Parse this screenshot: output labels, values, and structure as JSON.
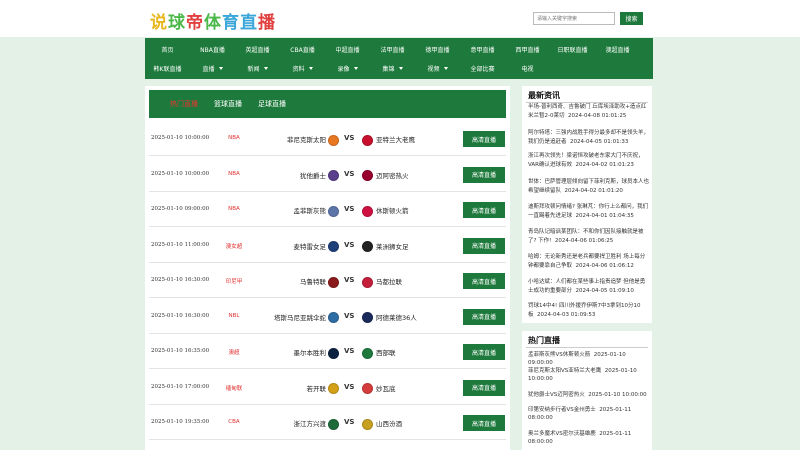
{
  "brand": {
    "chars": [
      "说",
      "球",
      "帝",
      "体",
      "育",
      "直",
      "播"
    ],
    "colors": [
      "#e8b820",
      "#4cb84a",
      "#e04040",
      "#4cb84a",
      "#3aa5d8",
      "#3aa5d8",
      "#e04040"
    ]
  },
  "search": {
    "placeholder": "请输入关键字搜索",
    "button": "搜索"
  },
  "nav": {
    "row1": [
      {
        "label": "首页"
      },
      {
        "label": "NBA直播"
      },
      {
        "label": "英超直播"
      },
      {
        "label": "CBA直播"
      },
      {
        "label": "中超直播"
      },
      {
        "label": "法甲直播"
      },
      {
        "label": "德甲直播"
      },
      {
        "label": "意甲直播"
      },
      {
        "label": "西甲直播"
      },
      {
        "label": "日职联直播"
      },
      {
        "label": "澳超直播"
      }
    ],
    "row2": [
      {
        "label": "韩K联直播",
        "dropdown": false
      },
      {
        "label": "直播",
        "dropdown": true
      },
      {
        "label": "新闻",
        "dropdown": true
      },
      {
        "label": "资料",
        "dropdown": true
      },
      {
        "label": "录像",
        "dropdown": true
      },
      {
        "label": "集锦",
        "dropdown": true
      },
      {
        "label": "视频",
        "dropdown": true
      },
      {
        "label": "全部比赛",
        "dropdown": false
      },
      {
        "label": "电视",
        "dropdown": false
      }
    ]
  },
  "tabs": [
    "热门直播",
    "篮球直播",
    "足球直播"
  ],
  "matches": [
    {
      "time": "2025-01-10 10:00:00",
      "league": "NBA",
      "home": "菲尼克斯太阳",
      "vs": "VS",
      "away": "亚特兰大老鹰",
      "button": "高清直播",
      "home_color": "#e87722",
      "away_color": "#c8102e"
    },
    {
      "time": "2025-01-10 10:00:00",
      "league": "NBA",
      "home": "犹他爵士",
      "vs": "VS",
      "away": "迈阿密热火",
      "button": "高清直播",
      "home_color": "#5b3f8c",
      "away_color": "#98002e"
    },
    {
      "time": "2025-01-10 09:00:00",
      "league": "NBA",
      "home": "孟菲斯灰熊",
      "vs": "VS",
      "away": "休斯顿火箭",
      "button": "高清直播",
      "home_color": "#5d76a9",
      "away_color": "#ce1141"
    },
    {
      "time": "2025-01-10 11:00:00",
      "league": "澳女超",
      "home": "麦特雷女足",
      "vs": "VS",
      "away": "莱洲狮女足",
      "button": "高清直播",
      "home_color": "#1d3f7a",
      "away_color": "#222222"
    },
    {
      "time": "2025-01-10 16:30:00",
      "league": "印尼甲",
      "home": "马鲁特联",
      "vs": "VS",
      "away": "马都拉联",
      "button": "高清直播",
      "home_color": "#8b1a1a",
      "away_color": "#c41e3a"
    },
    {
      "time": "2025-01-10 16:30:00",
      "league": "NBL",
      "home": "塔斯马尼亚跳伞蛇",
      "vs": "VS",
      "away": "阿德莱德36人",
      "button": "高清直播",
      "home_color": "#2e6da4",
      "away_color": "#1a2a5a"
    },
    {
      "time": "2025-01-10 16:35:00",
      "league": "澳超",
      "home": "墨尔本胜利",
      "vs": "VS",
      "away": "西部联",
      "button": "高清直播",
      "home_color": "#0a2240",
      "away_color": "#1e7a3c"
    },
    {
      "time": "2025-01-10 17:00:00",
      "league": "缅甸联",
      "home": "若开联",
      "vs": "VS",
      "away": "妙瓦底",
      "button": "高清直播",
      "home_color": "#d4a017",
      "away_color": "#d43c3c"
    },
    {
      "time": "2025-01-10 19:35:00",
      "league": "CBA",
      "home": "浙江方兴渡",
      "vs": "VS",
      "away": "山西汾酒",
      "button": "高清直播",
      "home_color": "#1e6b3a",
      "away_color": "#c8a020"
    }
  ],
  "news": {
    "title": "最新资讯",
    "items": [
      {
        "text": "半场-普利西奇、吉鲁破门 丘库埃泽助攻+造点红 米兰暂2-0莱切",
        "date": "2024-04-08 01:01:25"
      },
      {
        "text": "阿尔特塔：三强内战胜手得分最多却不是领头羊，我们仍是追赶者",
        "date": "2024-04-05 01:01:33"
      },
      {
        "text": "浙江再次领先！梁诺恒攻破老东家大门不庆祝，VAR确认进球有效",
        "date": "2024-04-02 01:01:23"
      },
      {
        "text": "世体：巴萨管理层倾向留下菲利克斯，球员本人也希望继续留队",
        "date": "2024-04-02 01:01:20"
      },
      {
        "text": "迪斯拜攻顿问情绪? 张琳芃：你行上么都问，我们一直踢着先进足球",
        "date": "2024-04-01 01:04:35"
      },
      {
        "text": "青岛队记暗讽某团队：不和你们因队接触就是被了? 下作!",
        "date": "2024-04-06 01:06:25"
      },
      {
        "text": "哈姆：无论新秀还是老兵都要捍卫胜利 场上每分钟都要靠自己争取",
        "date": "2024-04-06 01:06:12"
      },
      {
        "text": "小哈达斌：人们都在某些事上指责追梦 但他是勇士成功的重要部分",
        "date": "2024-04-05 01:09:10"
      },
      {
        "text": "罚球14中4! 四川外援乔伊斯7中3拿到10分10板",
        "date": "2024-04-03 01:09:53"
      }
    ]
  },
  "hot": {
    "title": "热门直播",
    "items": [
      {
        "text": "孟菲斯灰熊VS休斯顿火箭",
        "date": "2025-01-10 09:00:00"
      },
      {
        "text": "菲尼克斯太阳VS亚特兰大老鹰",
        "date": "2025-01-10 10:00:00"
      },
      {
        "text": "犹他爵士VS迈阿密热火",
        "date": "2025-01-10 10:00:00"
      },
      {
        "text": "印第安纳步行者VS金州勇士",
        "date": "2025-01-11 08:00:00"
      },
      {
        "text": "奥兰多魔术VS密尔沃基雄鹿",
        "date": "2025-01-11 08:00:00"
      }
    ]
  }
}
